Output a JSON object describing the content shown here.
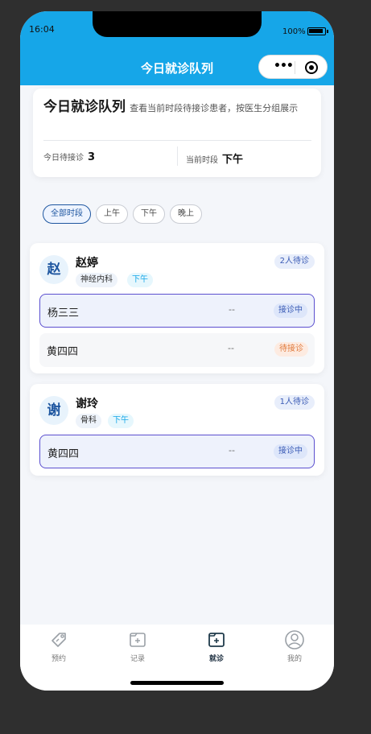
{
  "status_bar": {
    "time": "16:04",
    "battery": "100%"
  },
  "navbar": {
    "title": "今日就诊队列"
  },
  "summary": {
    "title": "今日就诊队列",
    "description": "查看当前时段待接诊患者，按医生分组展示",
    "waiting_label": "今日待接诊",
    "waiting_count": "3",
    "period_label": "当前时段",
    "period_value": "下午"
  },
  "filters": [
    {
      "label": "全部时段",
      "active": true
    },
    {
      "label": "上午",
      "active": false
    },
    {
      "label": "下午",
      "active": false
    },
    {
      "label": "晚上",
      "active": false
    }
  ],
  "doctors": [
    {
      "avatar": "赵",
      "name": "赵婷",
      "department": "神经内科",
      "period": "下午",
      "waiting": "2人待诊",
      "patients": [
        {
          "name": "杨三三",
          "info": "--",
          "status": "接诊中"
        },
        {
          "name": "黄四四",
          "info": "--",
          "status": "待接诊"
        }
      ]
    },
    {
      "avatar": "谢",
      "name": "谢玲",
      "department": "骨科",
      "period": "下午",
      "waiting": "1人待诊",
      "patients": [
        {
          "name": "黄四四",
          "info": "--",
          "status": "接诊中"
        }
      ]
    }
  ],
  "tabbar": [
    {
      "label": "预约",
      "icon": "appointment-tag-icon",
      "active": false
    },
    {
      "label": "记录",
      "icon": "record-icon",
      "active": false
    },
    {
      "label": "就诊",
      "icon": "visit-icon",
      "active": true
    },
    {
      "label": "我的",
      "icon": "profile-icon",
      "active": false
    }
  ],
  "colors": {
    "primary": "#16a6e8",
    "accent": "#1e56a0",
    "current_border": "#5b4fcf",
    "waiting_status": "#e07a3c"
  }
}
